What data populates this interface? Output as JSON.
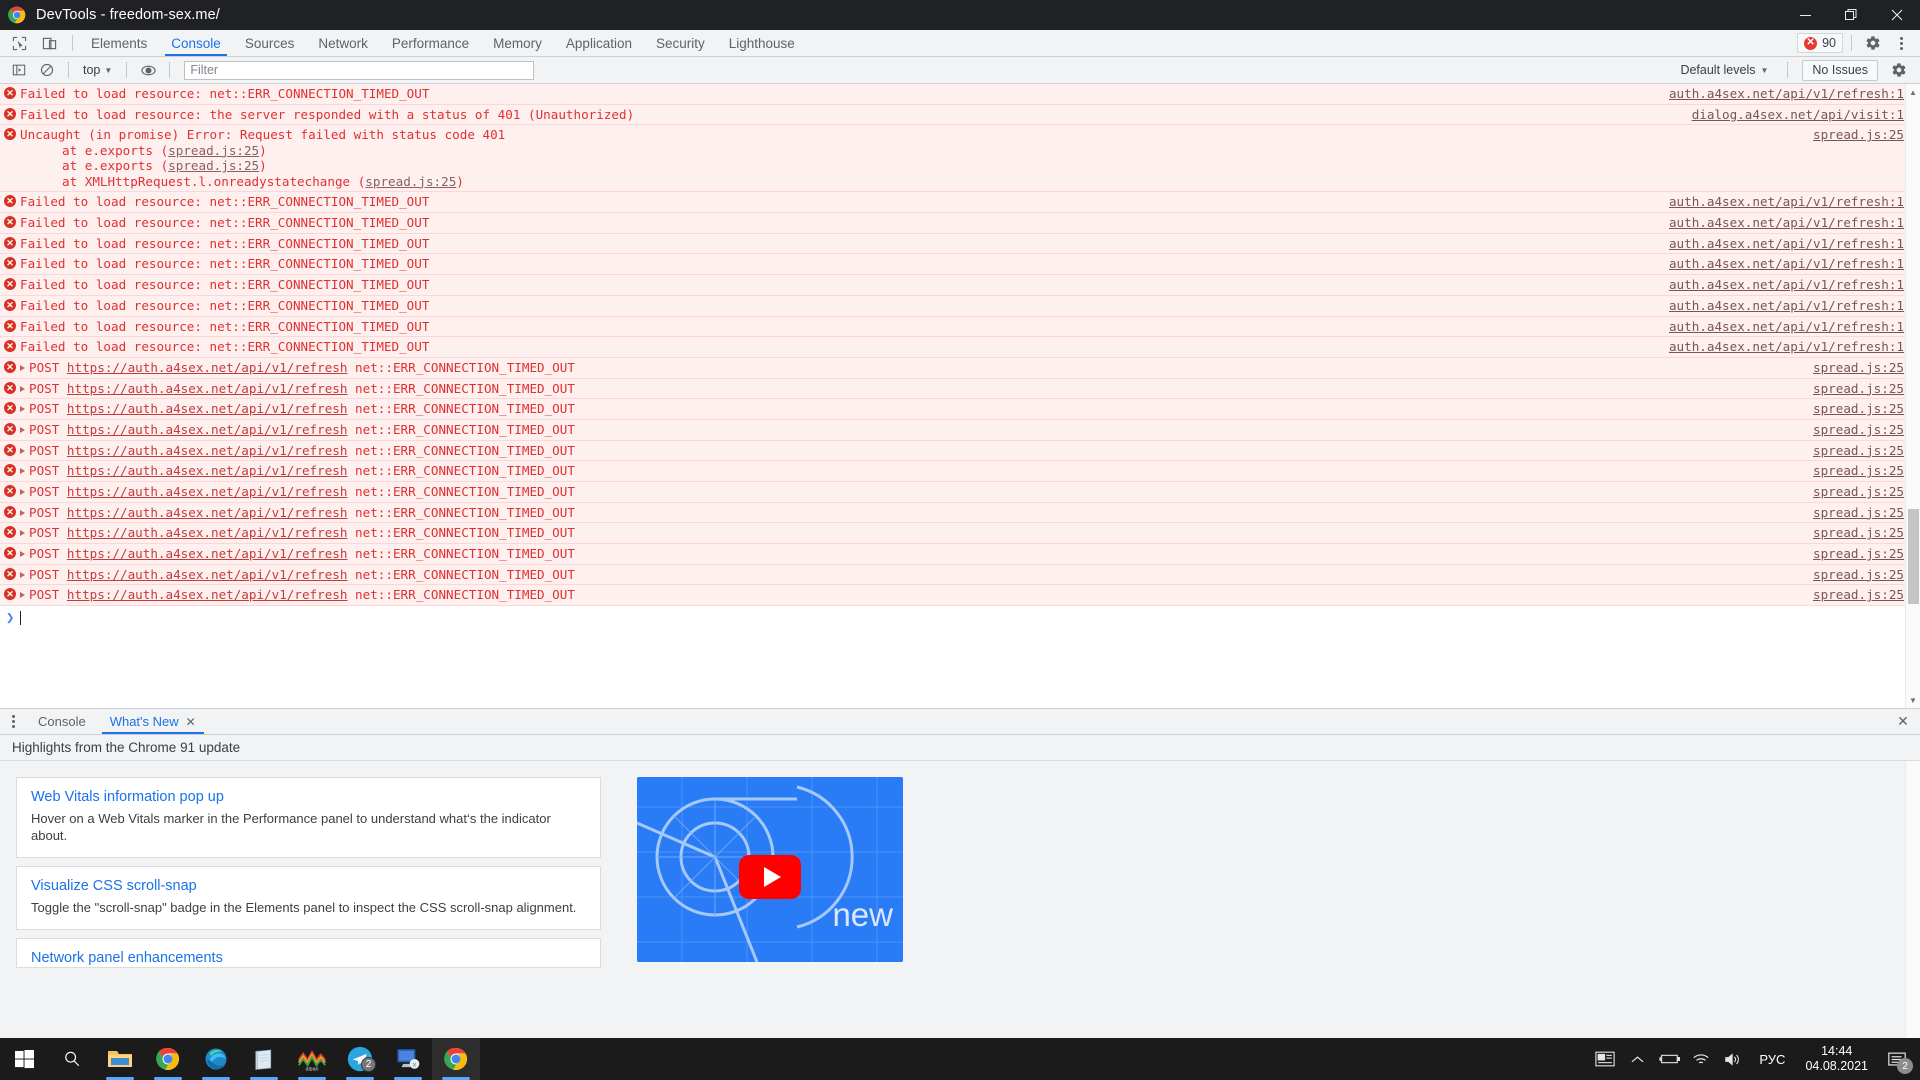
{
  "window": {
    "title": "DevTools - freedom-sex.me/",
    "controls": {
      "minimize": "minimize-icon",
      "maximize": "restore-icon",
      "close": "close-icon"
    }
  },
  "devtools": {
    "tool_icons": [
      "inspect-element-icon",
      "device-toolbar-icon"
    ],
    "tabs": [
      {
        "label": "Elements",
        "active": false
      },
      {
        "label": "Console",
        "active": true
      },
      {
        "label": "Sources",
        "active": false
      },
      {
        "label": "Network",
        "active": false
      },
      {
        "label": "Performance",
        "active": false
      },
      {
        "label": "Memory",
        "active": false
      },
      {
        "label": "Application",
        "active": false
      },
      {
        "label": "Security",
        "active": false
      },
      {
        "label": "Lighthouse",
        "active": false
      }
    ],
    "error_count": "90",
    "settings_icon": "gear-icon",
    "more_icon": "more-vertical-icon"
  },
  "console_toolbar": {
    "clear_icon": "clear-console-icon",
    "sidebar_icon": "console-sidebar-icon",
    "eye_icon": "live-expression-icon",
    "context": "top",
    "filter_placeholder": "Filter",
    "filter_value": "",
    "levels": "Default levels",
    "issues": "No Issues",
    "settings_icon": "gear-icon"
  },
  "console": {
    "messages": [
      {
        "type": "error",
        "text": "Failed to load resource: net::ERR_CONNECTION_TIMED_OUT",
        "source": "auth.a4sex.net/api/v1/refresh:1"
      },
      {
        "type": "error",
        "text": "Failed to load resource: the server responded with a status of 401 (Unauthorized)",
        "source": "dialog.a4sex.net/api/visit:1"
      },
      {
        "type": "error-stack",
        "text": "Uncaught (in promise) Error: Request failed with status code 401",
        "source": "spread.js:25",
        "frames": [
          {
            "prefix": "at e.exports (",
            "link": "spread.js:25",
            "suffix": ")"
          },
          {
            "prefix": "at e.exports (",
            "link": "spread.js:25",
            "suffix": ")"
          },
          {
            "prefix": "at XMLHttpRequest.l.onreadystatechange (",
            "link": "spread.js:25",
            "suffix": ")"
          }
        ]
      },
      {
        "type": "error",
        "text": "Failed to load resource: net::ERR_CONNECTION_TIMED_OUT",
        "source": "auth.a4sex.net/api/v1/refresh:1"
      },
      {
        "type": "error",
        "text": "Failed to load resource: net::ERR_CONNECTION_TIMED_OUT",
        "source": "auth.a4sex.net/api/v1/refresh:1"
      },
      {
        "type": "error",
        "text": "Failed to load resource: net::ERR_CONNECTION_TIMED_OUT",
        "source": "auth.a4sex.net/api/v1/refresh:1"
      },
      {
        "type": "error",
        "text": "Failed to load resource: net::ERR_CONNECTION_TIMED_OUT",
        "source": "auth.a4sex.net/api/v1/refresh:1"
      },
      {
        "type": "error",
        "text": "Failed to load resource: net::ERR_CONNECTION_TIMED_OUT",
        "source": "auth.a4sex.net/api/v1/refresh:1"
      },
      {
        "type": "error",
        "text": "Failed to load resource: net::ERR_CONNECTION_TIMED_OUT",
        "source": "auth.a4sex.net/api/v1/refresh:1"
      },
      {
        "type": "error",
        "text": "Failed to load resource: net::ERR_CONNECTION_TIMED_OUT",
        "source": "auth.a4sex.net/api/v1/refresh:1"
      },
      {
        "type": "error",
        "text": "Failed to load resource: net::ERR_CONNECTION_TIMED_OUT",
        "source": "auth.a4sex.net/api/v1/refresh:1"
      }
    ],
    "network_errors": [
      {
        "method": "POST",
        "url": "https://auth.a4sex.net/api/v1/refresh",
        "error": "net::ERR_CONNECTION_TIMED_OUT",
        "source": "spread.js:25"
      },
      {
        "method": "POST",
        "url": "https://auth.a4sex.net/api/v1/refresh",
        "error": "net::ERR_CONNECTION_TIMED_OUT",
        "source": "spread.js:25"
      },
      {
        "method": "POST",
        "url": "https://auth.a4sex.net/api/v1/refresh",
        "error": "net::ERR_CONNECTION_TIMED_OUT",
        "source": "spread.js:25"
      },
      {
        "method": "POST",
        "url": "https://auth.a4sex.net/api/v1/refresh",
        "error": "net::ERR_CONNECTION_TIMED_OUT",
        "source": "spread.js:25"
      },
      {
        "method": "POST",
        "url": "https://auth.a4sex.net/api/v1/refresh",
        "error": "net::ERR_CONNECTION_TIMED_OUT",
        "source": "spread.js:25"
      },
      {
        "method": "POST",
        "url": "https://auth.a4sex.net/api/v1/refresh",
        "error": "net::ERR_CONNECTION_TIMED_OUT",
        "source": "spread.js:25"
      },
      {
        "method": "POST",
        "url": "https://auth.a4sex.net/api/v1/refresh",
        "error": "net::ERR_CONNECTION_TIMED_OUT",
        "source": "spread.js:25"
      },
      {
        "method": "POST",
        "url": "https://auth.a4sex.net/api/v1/refresh",
        "error": "net::ERR_CONNECTION_TIMED_OUT",
        "source": "spread.js:25"
      },
      {
        "method": "POST",
        "url": "https://auth.a4sex.net/api/v1/refresh",
        "error": "net::ERR_CONNECTION_TIMED_OUT",
        "source": "spread.js:25"
      },
      {
        "method": "POST",
        "url": "https://auth.a4sex.net/api/v1/refresh",
        "error": "net::ERR_CONNECTION_TIMED_OUT",
        "source": "spread.js:25"
      },
      {
        "method": "POST",
        "url": "https://auth.a4sex.net/api/v1/refresh",
        "error": "net::ERR_CONNECTION_TIMED_OUT",
        "source": "spread.js:25"
      },
      {
        "method": "POST",
        "url": "https://auth.a4sex.net/api/v1/refresh",
        "error": "net::ERR_CONNECTION_TIMED_OUT",
        "source": "spread.js:25"
      }
    ],
    "prompt": ""
  },
  "drawer": {
    "tabs": [
      {
        "label": "Console",
        "active": false,
        "closeable": false
      },
      {
        "label": "What's New",
        "active": true,
        "closeable": true
      }
    ],
    "close_label": "✕",
    "whats_new": {
      "header": "Highlights from the Chrome 91 update",
      "cards": [
        {
          "title": "Web Vitals information pop up",
          "body": "Hover on a Web Vitals marker in the Performance panel to understand what‘s the indicator about."
        },
        {
          "title": "Visualize CSS scroll-snap",
          "body": "Toggle the \"scroll-snap\" badge in the Elements panel to inspect the CSS scroll-snap alignment."
        },
        {
          "title": "Network panel enhancements",
          "body": ""
        }
      ],
      "video_caption": "new"
    }
  },
  "taskbar": {
    "items": [
      {
        "name": "start-button",
        "icon": "windows-logo-icon",
        "running": false,
        "badge": ""
      },
      {
        "name": "search-button",
        "icon": "search-icon",
        "running": false,
        "badge": ""
      },
      {
        "name": "file-explorer",
        "icon": "folder-icon",
        "running": true,
        "badge": ""
      },
      {
        "name": "chrome-window-1",
        "icon": "chrome-icon",
        "running": true,
        "badge": ""
      },
      {
        "name": "microsoft-edge",
        "icon": "edge-icon",
        "running": true,
        "badge": ""
      },
      {
        "name": "notepad",
        "icon": "notepad-icon",
        "running": true,
        "badge": ""
      },
      {
        "name": "alpari",
        "icon": "alpari-icon",
        "running": true,
        "badge": "",
        "label": "alpari"
      },
      {
        "name": "telegram",
        "icon": "telegram-icon",
        "running": true,
        "badge": "2"
      },
      {
        "name": "remote-desktop",
        "icon": "remote-desktop-icon",
        "running": true,
        "badge": ""
      },
      {
        "name": "chrome-devtools-window",
        "icon": "chrome-icon",
        "running": true,
        "badge": "",
        "active": true
      }
    ],
    "tray": {
      "news_icon": "news-and-interests-icon",
      "chevron_icon": "show-hidden-icons-icon",
      "battery_icon": "battery-icon",
      "network_icon": "wifi-icon",
      "volume_icon": "volume-icon",
      "language": "РУС",
      "time": "14:44",
      "date": "04.08.2021",
      "notification_badge": "2"
    }
  }
}
